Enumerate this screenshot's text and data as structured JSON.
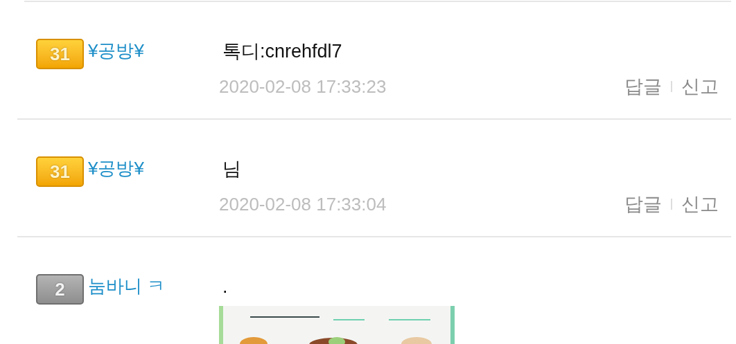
{
  "comments": [
    {
      "badge": {
        "kind": "gold",
        "level": "31"
      },
      "author": "¥공방¥",
      "text": "톡디:cnrehfdl7",
      "date": "2020-02-08 17:33:23",
      "actions": [
        "답글",
        "신고"
      ]
    },
    {
      "badge": {
        "kind": "gold",
        "level": "31"
      },
      "author": "¥공방¥",
      "text": "님",
      "date": "2020-02-08 17:33:04",
      "actions": [
        "답글",
        "신고"
      ]
    },
    {
      "badge": {
        "kind": "gray",
        "level": "2"
      },
      "author": "눔바니 ㅋ",
      "text": "."
    }
  ]
}
